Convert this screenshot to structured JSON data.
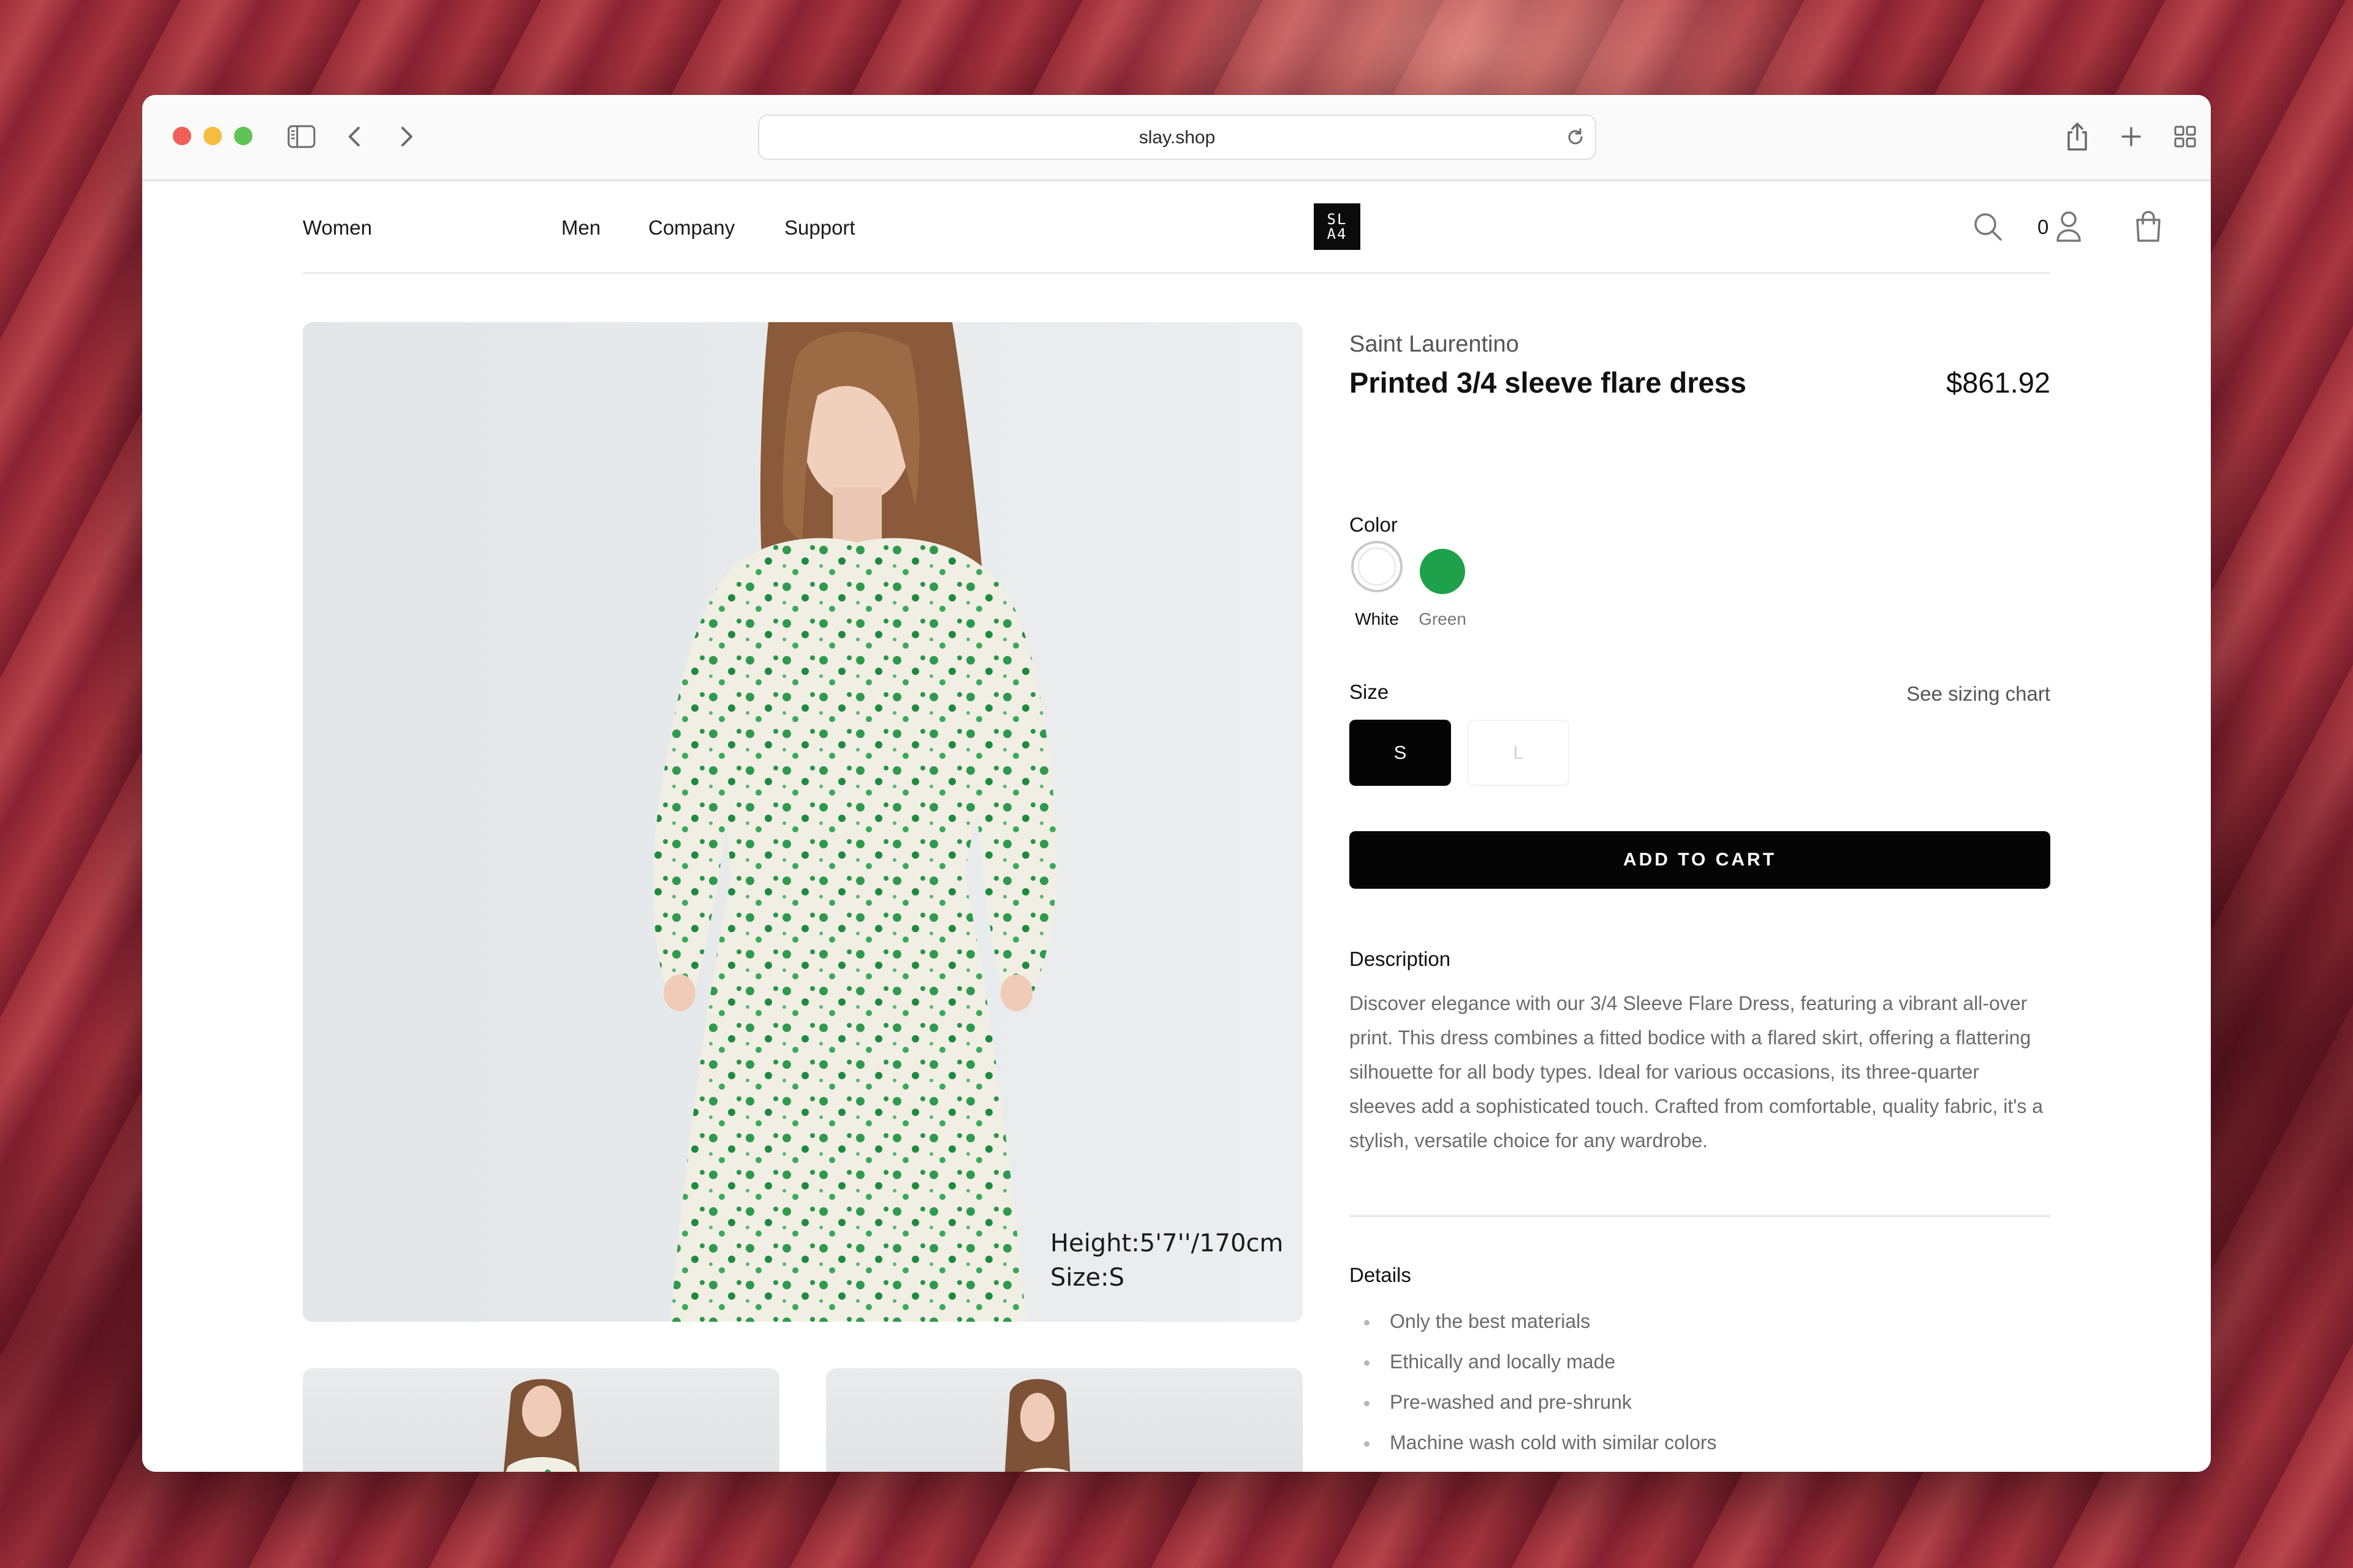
{
  "browser": {
    "url": "slay.shop"
  },
  "nav": {
    "links": [
      "Women",
      "Men",
      "Company",
      "Support"
    ],
    "logo_lines": [
      "SL",
      "A4"
    ],
    "cart_count": "0"
  },
  "product": {
    "brand": "Saint Laurentino",
    "title": "Printed 3/4 sleeve flare dress",
    "price": "$861.92",
    "image_caption": [
      "Height:5'7''/170cm",
      "Size:S"
    ],
    "color_label": "Color",
    "colors": [
      {
        "name": "White",
        "hex": "#ffffff",
        "selected": true
      },
      {
        "name": "Green",
        "hex": "#1ea14a",
        "selected": false
      }
    ],
    "size_label": "Size",
    "sizing_chart_link": "See sizing chart",
    "sizes": [
      {
        "label": "S",
        "selected": true,
        "available": true
      },
      {
        "label": "L",
        "selected": false,
        "available": false
      }
    ],
    "add_to_cart": "ADD TO CART",
    "description_heading": "Description",
    "description": "Discover elegance with our 3/4 Sleeve Flare Dress, featuring a vibrant all-over print. This dress combines a fitted bodice with a flared skirt, offering a flattering silhouette for all body types. Ideal for various occasions, its three-quarter sleeves add a sophisticated touch. Crafted from comfortable, quality fabric, it's a stylish, versatile choice for any wardrobe.",
    "details_heading": "Details",
    "details": [
      "Only the best materials",
      "Ethically and locally made",
      "Pre-washed and pre-shrunk",
      "Machine wash cold with similar colors"
    ]
  },
  "colors": {
    "accent": "#050505",
    "green_swatch": "#1ea14a"
  }
}
